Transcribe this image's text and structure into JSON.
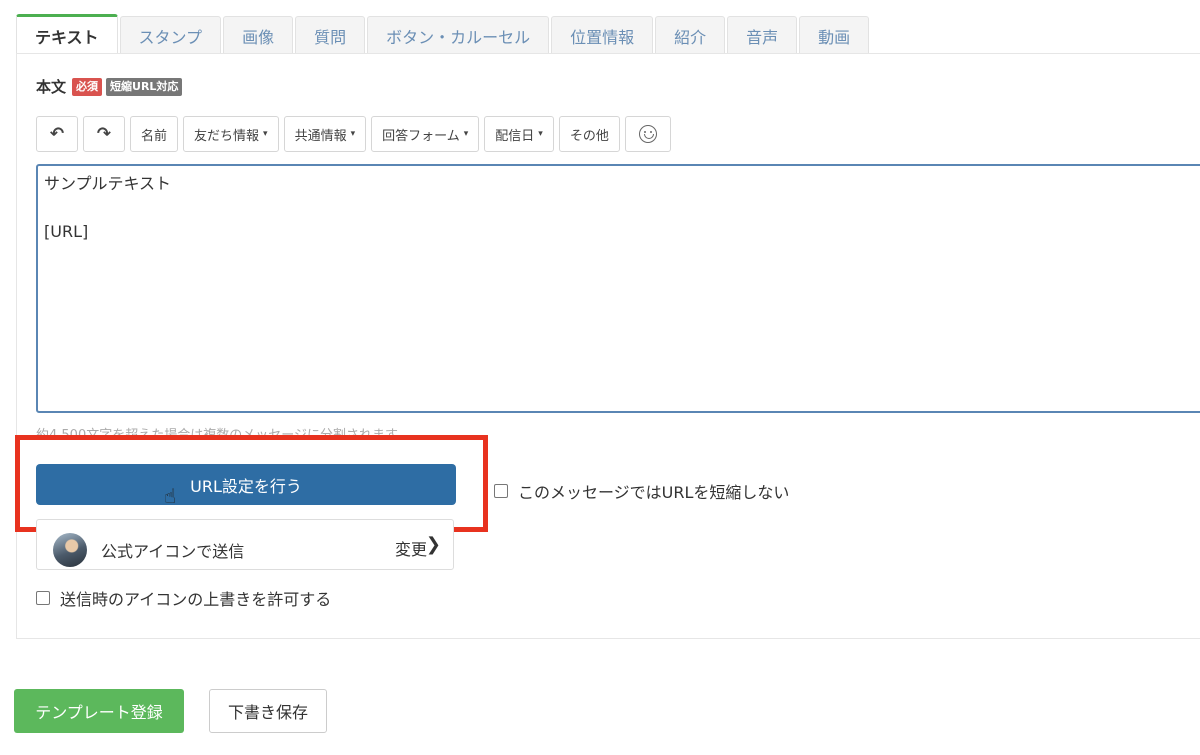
{
  "tabs": [
    {
      "label": "テキスト",
      "active": true
    },
    {
      "label": "スタンプ"
    },
    {
      "label": "画像"
    },
    {
      "label": "質問"
    },
    {
      "label": "ボタン・カルーセル"
    },
    {
      "label": "位置情報"
    },
    {
      "label": "紹介"
    },
    {
      "label": "音声"
    },
    {
      "label": "動画"
    }
  ],
  "body_field": {
    "label": "本文",
    "badge_required": "必須",
    "badge_short_url": "短縮URL対応"
  },
  "toolbar": {
    "undo_icon": "↶",
    "redo_icon": "↷",
    "name": "名前",
    "friend_info": "友だち情報",
    "common_info": "共通情報",
    "answer_form": "回答フォーム",
    "delivery_date": "配信日",
    "other": "その他",
    "caret": "▾"
  },
  "editor": {
    "value": "サンプルテキスト\n\n[URL]"
  },
  "hint": "約4,500文字を超えた場合は複数のメッセージに分割されます",
  "url_button_label": "URL設定を行う",
  "no_shorten_label": "このメッセージではURLを短縮しない",
  "icon_row": {
    "label": "公式アイコンで送信",
    "change": "変更",
    "chevron": "❯"
  },
  "allow_override_label": "送信時のアイコンの上書きを許可する",
  "buttons": {
    "template": "テンプレート登録",
    "draft": "下書き保存"
  },
  "colors": {
    "primary": "#2e6da4",
    "success": "#5cb85c",
    "highlight": "#e8321f",
    "tab_active": "#4caf50"
  }
}
